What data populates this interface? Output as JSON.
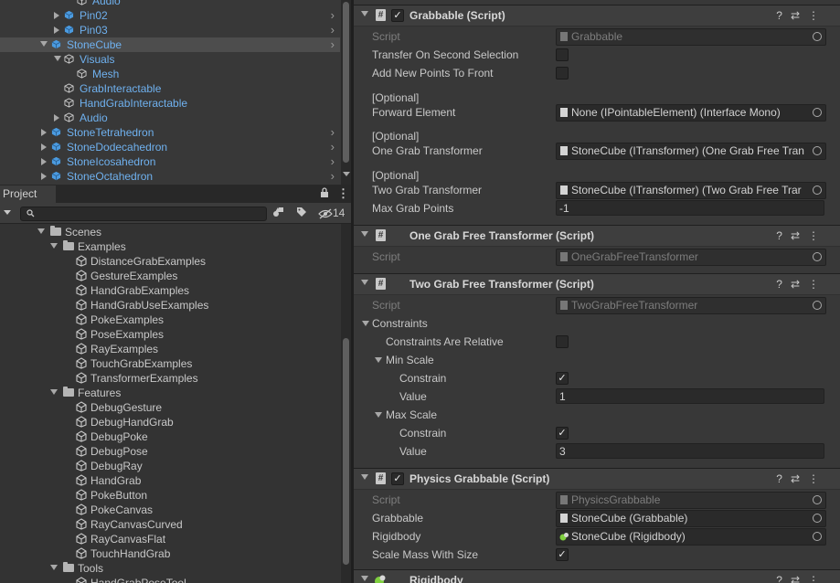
{
  "hierarchy": {
    "rows": [
      {
        "label": "Audio",
        "color": "blue"
      },
      {
        "label": "Pin02",
        "color": "blue"
      },
      {
        "label": "Pin03",
        "color": "blue"
      },
      {
        "label": "StoneCube",
        "color": "blue"
      },
      {
        "label": "Visuals",
        "color": "blue"
      },
      {
        "label": "Mesh",
        "color": "blue"
      },
      {
        "label": "GrabInteractable",
        "color": "blue"
      },
      {
        "label": "HandGrabInteractable",
        "color": "blue"
      },
      {
        "label": "Audio",
        "color": "blue"
      },
      {
        "label": "StoneTetrahedron",
        "color": "blue"
      },
      {
        "label": "StoneDodecahedron",
        "color": "blue"
      },
      {
        "label": "StoneIcosahedron",
        "color": "blue"
      },
      {
        "label": "StoneOctahedron",
        "color": "blue"
      }
    ]
  },
  "project": {
    "tab_label": "Project",
    "visible_count": "14",
    "tree": [
      {
        "label": "Scenes",
        "type": "folder"
      },
      {
        "label": "Examples",
        "type": "folder"
      },
      {
        "label": "DistanceGrabExamples",
        "type": "scene"
      },
      {
        "label": "GestureExamples",
        "type": "scene"
      },
      {
        "label": "HandGrabExamples",
        "type": "scene"
      },
      {
        "label": "HandGrabUseExamples",
        "type": "scene"
      },
      {
        "label": "PokeExamples",
        "type": "scene"
      },
      {
        "label": "PoseExamples",
        "type": "scene"
      },
      {
        "label": "RayExamples",
        "type": "scene"
      },
      {
        "label": "TouchGrabExamples",
        "type": "scene"
      },
      {
        "label": "TransformerExamples",
        "type": "scene"
      },
      {
        "label": "Features",
        "type": "folder"
      },
      {
        "label": "DebugGesture",
        "type": "scene"
      },
      {
        "label": "DebugHandGrab",
        "type": "scene"
      },
      {
        "label": "DebugPoke",
        "type": "scene"
      },
      {
        "label": "DebugPose",
        "type": "scene"
      },
      {
        "label": "DebugRay",
        "type": "scene"
      },
      {
        "label": "HandGrab",
        "type": "scene"
      },
      {
        "label": "PokeButton",
        "type": "scene"
      },
      {
        "label": "PokeCanvas",
        "type": "scene"
      },
      {
        "label": "RayCanvasCurved",
        "type": "scene"
      },
      {
        "label": "RayCanvasFlat",
        "type": "scene"
      },
      {
        "label": "TouchHandGrab",
        "type": "scene"
      },
      {
        "label": "Tools",
        "type": "folder"
      },
      {
        "label": "HandGrabPoseTool",
        "type": "scene"
      }
    ]
  },
  "inspector": {
    "grabbable": {
      "title": "Grabbable (Script)",
      "script_label": "Script",
      "script_value": "Grabbable",
      "transfer_label": "Transfer On Second Selection",
      "add_points_label": "Add New Points To Front",
      "optional1": "[Optional]",
      "forward_label": "Forward Element",
      "forward_value": "None (IPointableElement) (Interface Mono)",
      "optional2": "[Optional]",
      "one_grab_label": "One Grab Transformer",
      "one_grab_value": "StoneCube (ITransformer) (One Grab Free Tran",
      "optional3": "[Optional]",
      "two_grab_label": "Two Grab Transformer",
      "two_grab_value": "StoneCube (ITransformer) (Two Grab Free Trar",
      "max_points_label": "Max Grab Points",
      "max_points_value": "-1"
    },
    "one_grab_free": {
      "title": "One Grab Free Transformer (Script)",
      "script_label": "Script",
      "script_value": "OneGrabFreeTransformer"
    },
    "two_grab_free": {
      "title": "Two Grab Free Transformer (Script)",
      "script_label": "Script",
      "script_value": "TwoGrabFreeTransformer",
      "constraints_label": "Constraints",
      "relative_label": "Constraints Are Relative",
      "min_scale_label": "Min Scale",
      "min_constrain_label": "Constrain",
      "min_value_label": "Value",
      "min_value": "1",
      "max_scale_label": "Max Scale",
      "max_constrain_label": "Constrain",
      "max_value_label": "Value",
      "max_value": "3"
    },
    "physics_grabbable": {
      "title": "Physics Grabbable (Script)",
      "script_label": "Script",
      "script_value": "PhysicsGrabbable",
      "grabbable_label": "Grabbable",
      "grabbable_value": "StoneCube (Grabbable)",
      "rigidbody_label": "Rigidbody",
      "rigidbody_value": "StoneCube (Rigidbody)",
      "scale_mass_label": "Scale Mass With Size"
    },
    "rigidbody": {
      "title": "Rigidbody"
    }
  },
  "icons": {
    "hash": "#",
    "check": "✓",
    "lock": "🔒",
    "more": "⋮"
  }
}
